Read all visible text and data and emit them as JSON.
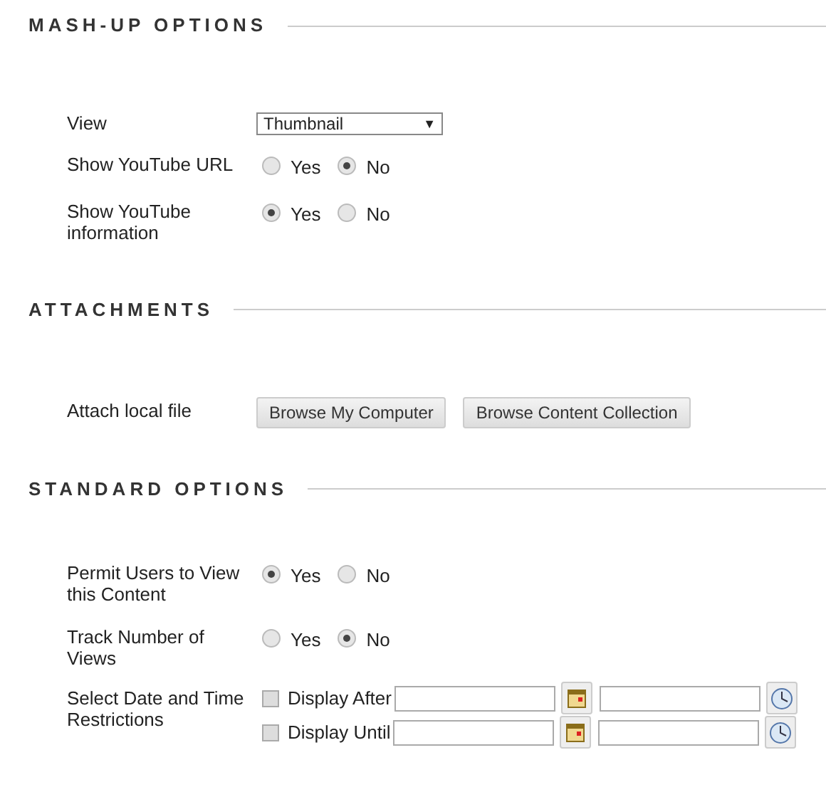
{
  "sections": [
    {
      "title": "MASH-UP OPTIONS",
      "fields": [
        {
          "kind": "select",
          "label": "View",
          "value": "Thumbnail",
          "caret": "▼"
        },
        {
          "kind": "radio",
          "label": "Show YouTube URL",
          "options": [
            {
              "label": "Yes",
              "selected": false
            },
            {
              "label": "No",
              "selected": true
            }
          ]
        },
        {
          "kind": "radio",
          "label": "Show YouTube information",
          "options": [
            {
              "label": "Yes",
              "selected": true
            },
            {
              "label": "No",
              "selected": false
            }
          ]
        }
      ]
    },
    {
      "title": "ATTACHMENTS",
      "fields": [
        {
          "kind": "buttons",
          "label": "Attach local file",
          "buttons": [
            "Browse My Computer",
            "Browse Content Collection"
          ]
        }
      ]
    },
    {
      "title": "STANDARD OPTIONS",
      "fields": [
        {
          "kind": "radio",
          "label": "Permit Users to View this Content",
          "options": [
            {
              "label": "Yes",
              "selected": true
            },
            {
              "label": "No",
              "selected": false
            }
          ]
        },
        {
          "kind": "radio",
          "label": "Track Number of Views",
          "options": [
            {
              "label": "Yes",
              "selected": false
            },
            {
              "label": "No",
              "selected": true
            }
          ]
        },
        {
          "kind": "dates",
          "label": "Select Date and Time Restrictions",
          "rows": [
            {
              "label": "Display After",
              "checked": false
            },
            {
              "label": "Display Until",
              "checked": false
            }
          ]
        }
      ]
    }
  ]
}
